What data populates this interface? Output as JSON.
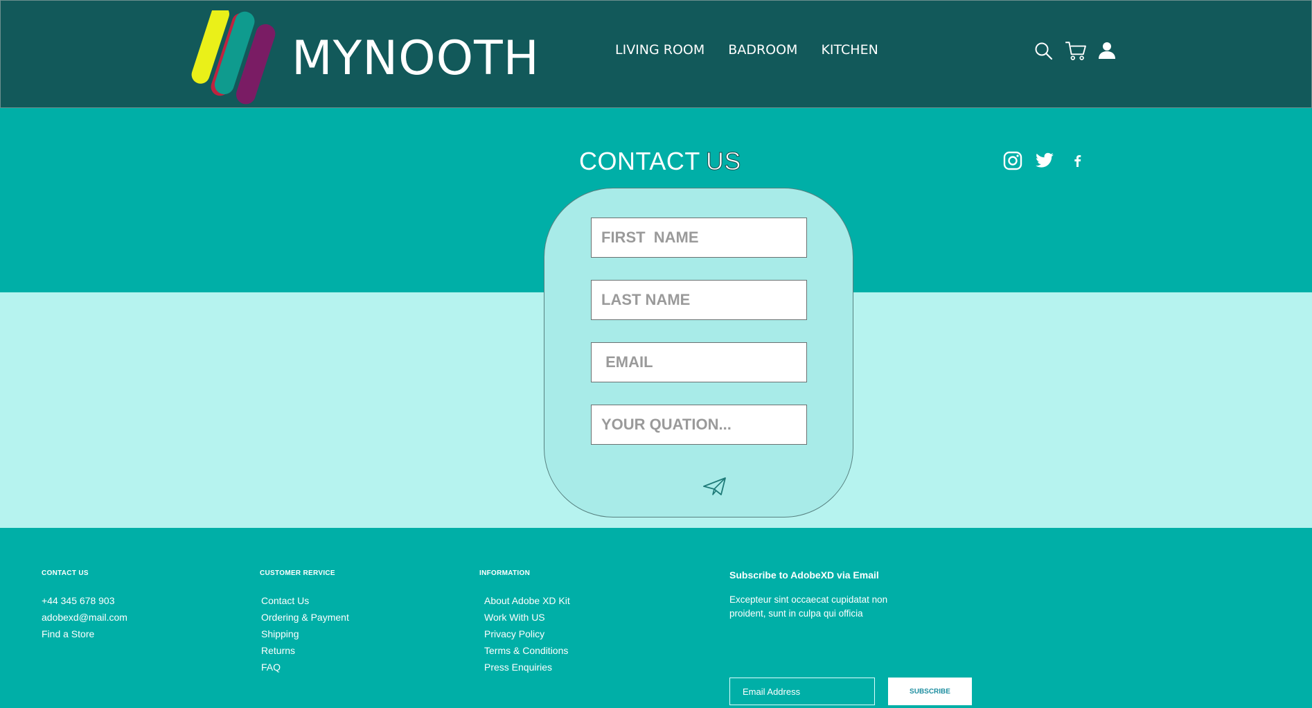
{
  "header": {
    "brand": "MYNOOTH",
    "nav": [
      "LIVING ROOM",
      "BADROOM",
      "KITCHEN"
    ],
    "icons": [
      "search-icon",
      "cart-icon",
      "user-icon"
    ]
  },
  "contact": {
    "title_part1": "CONTACT",
    "title_part2": "US",
    "social": [
      "instagram-icon",
      "twitter-icon",
      "facebook-icon"
    ],
    "form": {
      "first_name_placeholder": "FIRST  NAME",
      "last_name_placeholder": "LAST NAME",
      "email_placeholder": " EMAIL",
      "question_placeholder": "YOUR QUATION...",
      "send_icon": "paper-plane-icon"
    }
  },
  "footer": {
    "contact": {
      "heading": "CONTACT US",
      "items": [
        "+44 345 678 903",
        "adobexd@mail.com",
        "Find a Store"
      ]
    },
    "customer_service": {
      "heading": "CUSTOMER RERVICE",
      "items": [
        "Contact Us",
        "Ordering & Payment",
        "Shipping",
        "Returns",
        "FAQ"
      ]
    },
    "information": {
      "heading": "INFORMATION",
      "items": [
        "About Adobe XD Kit",
        "Work With US",
        "Privacy Policy",
        "Terms & Conditions",
        "Press Enquiries"
      ]
    },
    "subscribe": {
      "title": "Subscribe to AdobeXD via Email",
      "text": "Excepteur sint occaecat cupidatat non proident, sunt in culpa qui officia",
      "email_placeholder": "Email Address",
      "button": "SUBSCRIBE"
    }
  },
  "colors": {
    "header_bg": "#12595a",
    "teal": "#00afa7",
    "light_teal": "#b6f3ef",
    "card": "#a8ebe8"
  }
}
